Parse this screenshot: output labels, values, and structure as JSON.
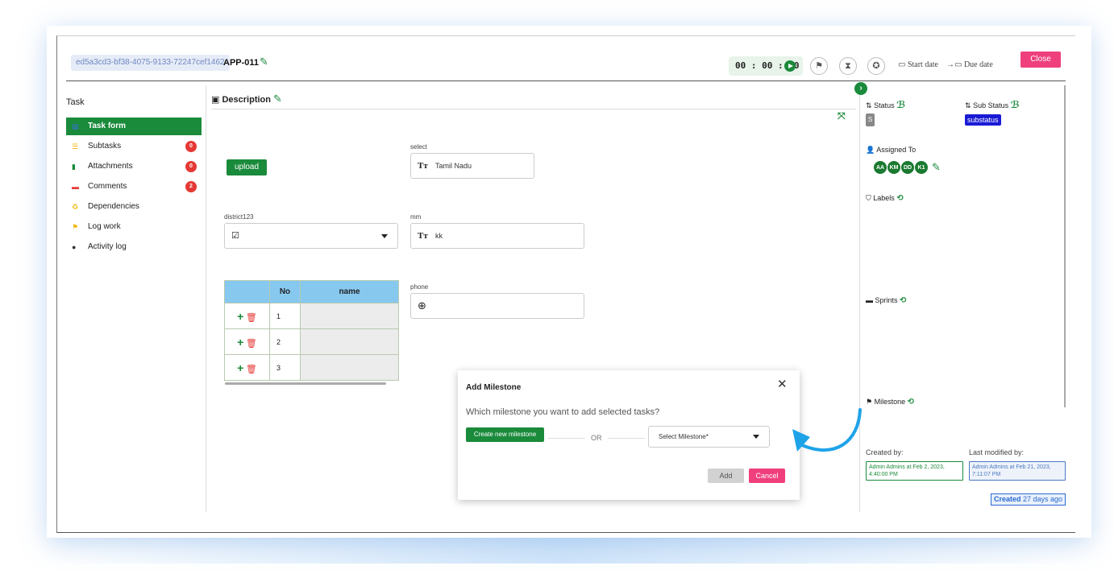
{
  "header": {
    "task_id": "ed5a3cd3-bf38-4075-9133-72247cef1462",
    "task_code": "APP-011",
    "timer": "00 : 00 : 00",
    "start_date": "Start date",
    "arrow": "→",
    "due_date": "Due date",
    "close_label": "Close"
  },
  "sidebar": {
    "title": "Task",
    "items": [
      {
        "label": "Task form",
        "icon": "form-icon",
        "color": "#3a6de0"
      },
      {
        "label": "Subtasks",
        "icon": "subtasks-icon",
        "badge": "0",
        "color": "#f2b705"
      },
      {
        "label": "Attachments",
        "icon": "attachment-icon",
        "badge": "0",
        "color": "#1a8a3b"
      },
      {
        "label": "Comments",
        "icon": "comment-icon",
        "badge": "2",
        "color": "#e53935"
      },
      {
        "label": "Dependencies",
        "icon": "dependency-icon",
        "color": "#f2b705"
      },
      {
        "label": "Log work",
        "icon": "flag-icon",
        "color": "#f2b705"
      },
      {
        "label": "Activity log",
        "icon": "activity-icon",
        "color": "#333333"
      }
    ]
  },
  "main": {
    "description_label": "Description",
    "upload_label": "upload",
    "select_label": "select",
    "select_value": "Tamil Nadu",
    "district_label": "district123",
    "mm_label": "mm",
    "mm_value": "kk",
    "phone_label": "phone",
    "table": {
      "headers": [
        "",
        "No",
        "name"
      ],
      "rows": [
        {
          "no": "1",
          "name": ""
        },
        {
          "no": "2",
          "name": ""
        },
        {
          "no": "3",
          "name": ""
        }
      ]
    }
  },
  "right": {
    "status_label": "Status",
    "status_value": "S",
    "sub_status_label": "Sub Status",
    "sub_status_value": "substatus",
    "assigned_label": "Assigned To",
    "assignees": [
      "AA",
      "KM",
      "DD",
      "K1"
    ],
    "labels_label": "Labels",
    "sprints_label": "Sprints",
    "milestone_label": "Milestone",
    "created_by_label": "Created by:",
    "created_by_value": "Admin Admins at Feb 2, 2023, 4:40:00 PM",
    "modified_by_label": "Last modified by:",
    "modified_by_value": "Admin Admins at Feb 21, 2023, 7:11:07 PM",
    "created_strong": "Created",
    "created_ago": " 27 days ago"
  },
  "modal": {
    "title": "Add Milestone",
    "question": "Which milestone you want to add selected tasks?",
    "create_label": "Create new milestone",
    "or_label": "OR",
    "select_placeholder": "Select Milestone*",
    "add_label": "Add",
    "cancel_label": "Cancel"
  },
  "colors": {
    "brand_green": "#1a8a3b",
    "close_pink": "#ef3f7d",
    "header_blue": "#87c8ef",
    "badge_red": "#e53935"
  }
}
